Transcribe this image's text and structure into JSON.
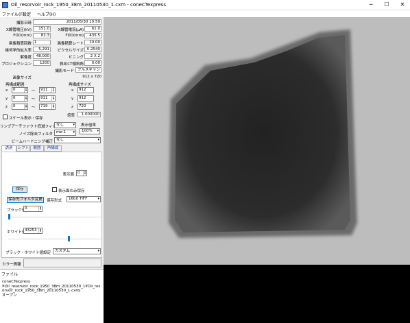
{
  "window": {
    "title": "Oil_resorvoir_rock_1950_38m_20110530_1.cxm - coneCTexpress",
    "minimize": "─",
    "maximize": "☐",
    "close": "✕",
    "accent": "#0078d7"
  },
  "menu": {
    "file": "ファイル(F)",
    "settings": "設定",
    "help": "ヘルプ(H)"
  },
  "info": {
    "date_label": "撮影日時",
    "date_value": "2011/05/30 10:59",
    "voltage_label": "X線管電圧(kV)",
    "voltage_value": "151.0",
    "current_label": "X線管電流(μA)",
    "current_value": "61.0",
    "fod_label": "FOD(mm)",
    "fod_value": "82.3",
    "fdd_label": "FDD(mm)",
    "fdd_value": "435.5",
    "integ_count_label": "画像積算回数",
    "integ_count_value": "1",
    "integ_rate_label": "画像積算レート",
    "integ_rate_value": "20.00",
    "mag_label": "幾何学的拡大率",
    "mag_value": "5.291",
    "pixel_label": "ピクセルサイズ",
    "pixel_value": "0.2540",
    "res_label": "解像度",
    "res_value": "48.000",
    "binning_label": "ビニング",
    "binning_value": "2 X 2",
    "proj_label": "プロジェクション",
    "proj_value": "1200",
    "tilt_label": "斜めCT傾斜角",
    "tilt_value": "0.00",
    "mode_label": "撮影モード",
    "mode_value": "フルスキャン",
    "imgsize_label": "画像サイズ",
    "imgsize_value": "912 x 720"
  },
  "recon": {
    "range_title": "再構成範囲",
    "size_title": "再構成サイズ",
    "x_label": "x",
    "x_from": "0",
    "tilde": "〜",
    "x_to": "911",
    "x_size": "912",
    "y_label": "y",
    "y_from": "0",
    "y_to": "911",
    "y_size": "912",
    "z_label": "z",
    "z_from": "0",
    "z_to": "719",
    "z_size": "720",
    "ratio_label": "倍率",
    "ratio_value": "1.000000",
    "scale_checkbox": "スケール表示・保存",
    "ring_label": "リングアーチファクト低減フィルタ",
    "ring_value": "なし",
    "noise_label": "ノイズ除去フィルタ",
    "noise_value": "me-1",
    "beam_label": "ビームハードニング補正",
    "beam_value": "なし",
    "disprate_label": "表示倍率",
    "disprate_value": "100%"
  },
  "tabs": [
    "透過",
    "シフト",
    "範囲",
    "再構成"
  ],
  "transmission": {
    "display_face_label": "表示面",
    "display_face_value": "0",
    "save_button": "保存",
    "only_display_checkbox": "表示面のみ保存",
    "folder_button": "保存先フォルダ変更",
    "format_label": "保存形式",
    "format_value": "16bit TIFF",
    "black_label": "ブラック値",
    "black_value": "0",
    "black_level": 0.0,
    "white_label": "ホワイト値",
    "white_value": "43253",
    "white_level": 0.66,
    "bw_label": "ブラック・ホワイト値設定",
    "bw_value": "カスタム"
  },
  "color_info_label": "カラー情報",
  "file_panel": {
    "header": "ファイル",
    "lines": [
      "coneCTexpress",
      "¥Oil_resorvoir_rock_1950_38m_20110530_1¥Oil_resorvoir_rock_1950_38m_20110530_1.cxm|",
      "オープン"
    ]
  }
}
